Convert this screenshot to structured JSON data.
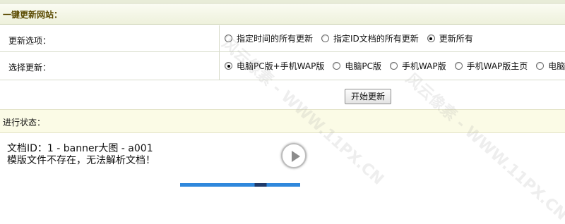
{
  "section_title": "一键更新网站：",
  "update_options": {
    "label": "更新选项：",
    "options": [
      {
        "label": "指定时间的所有更新",
        "checked": false
      },
      {
        "label": "指定ID文档的所有更新",
        "checked": false
      },
      {
        "label": "更新所有",
        "checked": true
      }
    ]
  },
  "select_update": {
    "label": "选择更新：",
    "options": [
      {
        "label": "电脑PC版+手机WAP版",
        "checked": true
      },
      {
        "label": "电脑PC版",
        "checked": false
      },
      {
        "label": "手机WAP版",
        "checked": false
      },
      {
        "label": "手机WAP版主页",
        "checked": false
      },
      {
        "label": "电脑PC版主",
        "checked": false
      }
    ]
  },
  "start_button_label": "开始更新",
  "status": {
    "label": "进行状态：",
    "lines": [
      "文档ID：1 - banner大图 - a001",
      "模版文件不存在，无法解析文档！"
    ]
  },
  "watermark_text": "风云像素 - WWW.11PX.CN",
  "colors": {
    "title_text": "#5a4a00",
    "status_bg": "#fbfbe6",
    "accent_blue": "#2f88dc"
  }
}
